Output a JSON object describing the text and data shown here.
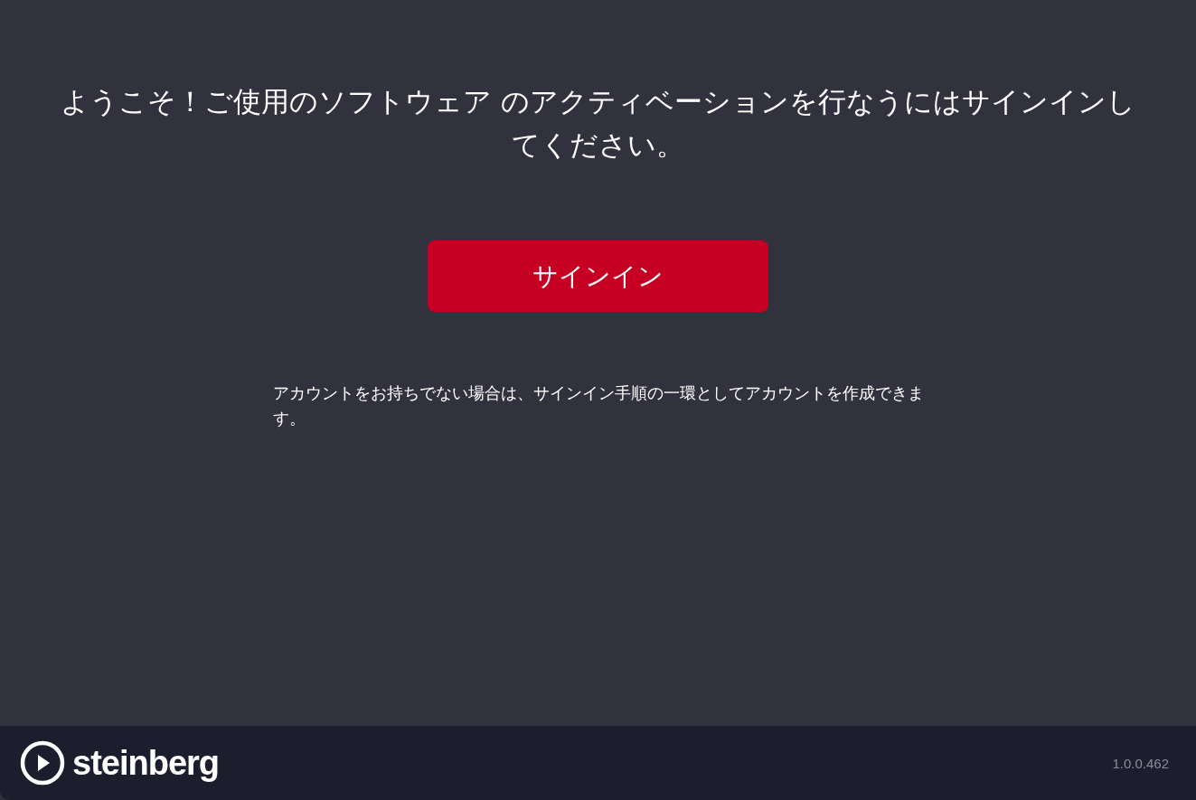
{
  "heading": "ようこそ！ご使用のソフトウェア のアクティベーションを行なうにはサインインしてください。",
  "sign_in_button": "サインイン",
  "note": "アカウントをお持ちでない場合は、サインイン手順の一環としてアカウントを作成できます。",
  "footer": {
    "logo_text": "steinberg",
    "version": "1.0.0.462"
  }
}
